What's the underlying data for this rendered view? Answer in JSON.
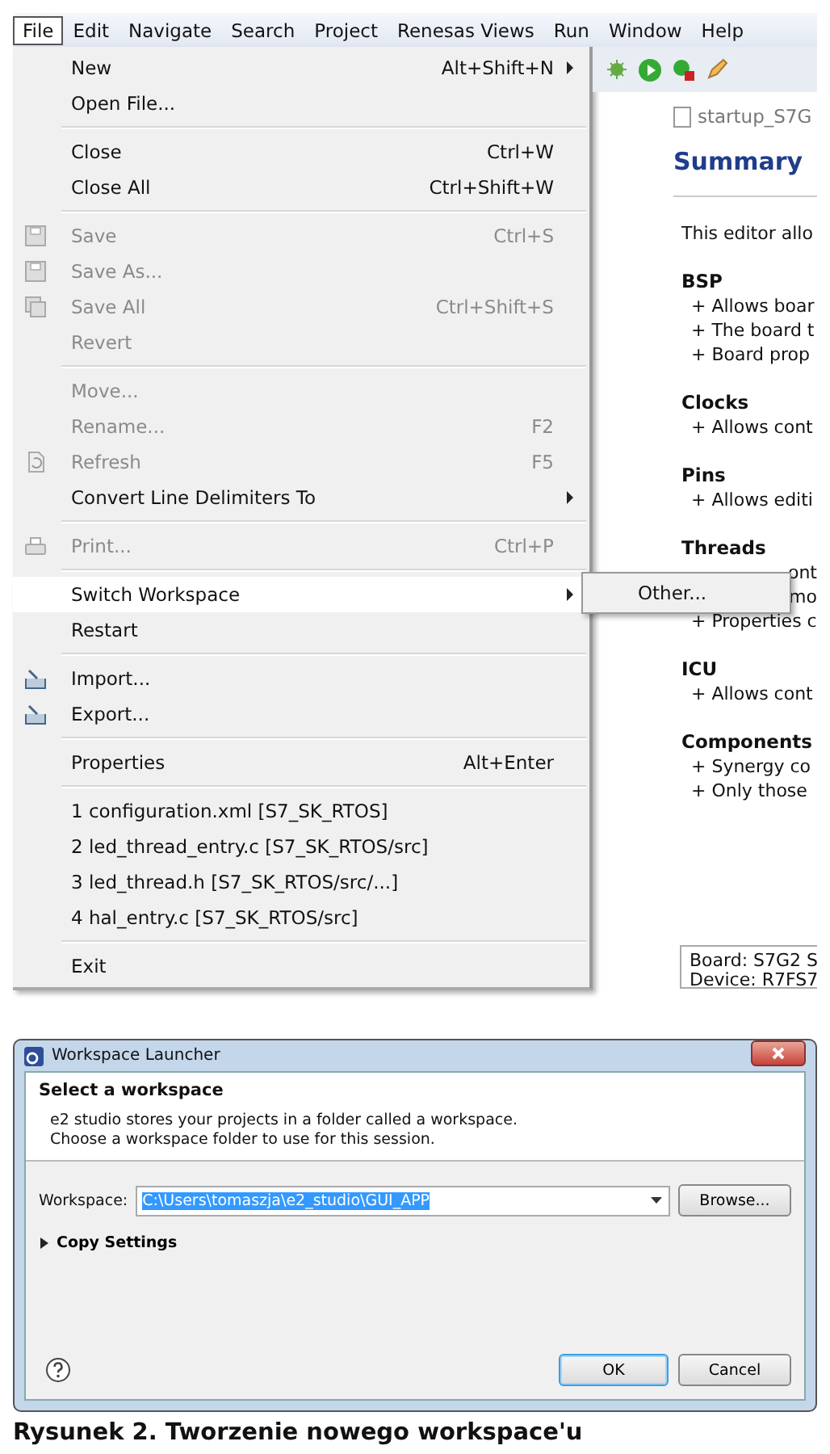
{
  "menubar": [
    {
      "label": "File",
      "selected": true
    },
    {
      "label": "Edit",
      "selected": false
    },
    {
      "label": "Navigate",
      "selected": false
    },
    {
      "label": "Search",
      "selected": false
    },
    {
      "label": "Project",
      "selected": false
    },
    {
      "label": "Renesas Views",
      "selected": false
    },
    {
      "label": "Run",
      "selected": false
    },
    {
      "label": "Window",
      "selected": false
    },
    {
      "label": "Help",
      "selected": false
    }
  ],
  "file_menu": [
    [
      {
        "kind": "submenu",
        "label": "New",
        "shortcut": "Alt+Shift+N",
        "disabled": false,
        "selected": false
      },
      {
        "kind": "plain",
        "label": "Open File...",
        "disabled": false,
        "selected": false
      }
    ],
    [
      {
        "kind": "plain",
        "label": "Close",
        "shortcut": "Ctrl+W",
        "disabled": false,
        "selected": false
      },
      {
        "kind": "plain",
        "label": "Close All",
        "shortcut": "Ctrl+Shift+W",
        "disabled": false,
        "selected": false
      }
    ],
    [
      {
        "kind": "disk",
        "label": "Save",
        "shortcut": "Ctrl+S",
        "disabled": true,
        "selected": false
      },
      {
        "kind": "disk",
        "label": "Save As...",
        "disabled": true,
        "selected": false
      },
      {
        "kind": "disks",
        "label": "Save All",
        "shortcut": "Ctrl+Shift+S",
        "disabled": true,
        "selected": false
      },
      {
        "kind": "plain",
        "label": "Revert",
        "disabled": true,
        "selected": false
      }
    ],
    [
      {
        "kind": "plain",
        "label": "Move...",
        "disabled": true,
        "selected": false
      },
      {
        "kind": "plain",
        "label": "Rename...",
        "shortcut": "F2",
        "disabled": true,
        "selected": false
      },
      {
        "kind": "refresh",
        "label": "Refresh",
        "shortcut": "F5",
        "disabled": true,
        "selected": false
      },
      {
        "kind": "submenu",
        "label": "Convert Line Delimiters To",
        "disabled": false,
        "selected": false
      }
    ],
    [
      {
        "kind": "printer",
        "label": "Print...",
        "shortcut": "Ctrl+P",
        "disabled": true,
        "selected": false
      }
    ],
    [
      {
        "kind": "submenu",
        "label": "Switch Workspace",
        "disabled": false,
        "selected": true
      },
      {
        "kind": "plain",
        "label": "Restart",
        "disabled": false,
        "selected": false
      }
    ],
    [
      {
        "kind": "import",
        "label": "Import...",
        "disabled": false,
        "selected": false
      },
      {
        "kind": "export",
        "label": "Export...",
        "disabled": false,
        "selected": false
      }
    ],
    [
      {
        "kind": "plain",
        "label": "Properties",
        "shortcut": "Alt+Enter",
        "disabled": false,
        "selected": false
      }
    ],
    [
      {
        "kind": "plain",
        "label": "1 configuration.xml  [S7_SK_RTOS]",
        "disabled": false,
        "selected": false
      },
      {
        "kind": "plain",
        "label": "2 led_thread_entry.c  [S7_SK_RTOS/src]",
        "disabled": false,
        "selected": false
      },
      {
        "kind": "plain",
        "label": "3 led_thread.h  [S7_SK_RTOS/src/...]",
        "disabled": false,
        "selected": false
      },
      {
        "kind": "plain",
        "label": "4 hal_entry.c  [S7_SK_RTOS/src]",
        "disabled": false,
        "selected": false
      }
    ],
    [
      {
        "kind": "plain",
        "label": "Exit",
        "disabled": false,
        "selected": false
      }
    ]
  ],
  "submenu": {
    "label": "Other..."
  },
  "editor": {
    "tab": "startup_S7G",
    "title": "Summary",
    "intro": "This editor allo",
    "sections": [
      {
        "heading": "BSP",
        "items": [
          "+ Allows boar",
          "+ The board t",
          "+ Board prop"
        ]
      },
      {
        "heading": "Clocks",
        "items": [
          "+ Allows cont"
        ]
      },
      {
        "heading": "Pins",
        "items": [
          "+ Allows editi"
        ]
      },
      {
        "heading": "Threads",
        "items": [
          "ont",
          "mo",
          "+ Properties c"
        ],
        "covered": [
          true,
          true,
          false
        ]
      },
      {
        "heading": "ICU",
        "items": [
          "+ Allows cont"
        ]
      },
      {
        "heading": "Components",
        "items": [
          "+ Synergy co",
          "+ Only those"
        ]
      }
    ],
    "info": [
      "Board: S7G2 S",
      "Device: R7FS7"
    ]
  },
  "dialog": {
    "title": "Workspace Launcher",
    "heading": "Select a workspace",
    "description": [
      "e2 studio stores your projects in a folder called a workspace.",
      "Choose a workspace folder to use for this session."
    ],
    "workspace_label": "Workspace:",
    "workspace_value": "C:\\Users\\tomaszja\\e2_studio\\GUI_APP",
    "browse": "Browse...",
    "copy_settings": {
      "label": "Copy Settings",
      "expanded": false
    },
    "buttons": [
      {
        "label": "OK",
        "selected": true
      },
      {
        "label": "Cancel",
        "selected": false
      }
    ]
  },
  "caption": "Rysunek 2. Tworzenie nowego workspace'u"
}
